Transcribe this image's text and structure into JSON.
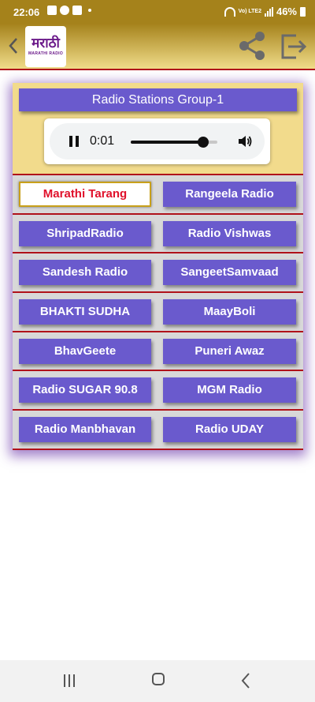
{
  "status_bar": {
    "time": "22:06",
    "battery": "46%",
    "network_label": "Vo) LTE2"
  },
  "app_bar": {
    "logo_main": "मराठी",
    "logo_sub": "MARATHI RADIO"
  },
  "group_title": "Radio Stations Group-1",
  "player": {
    "time": "0:01",
    "progress": 0.84
  },
  "stations": [
    [
      "Marathi Tarang",
      "Rangeela Radio"
    ],
    [
      "ShripadRadio",
      "Radio Vishwas"
    ],
    [
      "Sandesh Radio",
      "SangeetSamvaad"
    ],
    [
      "BHAKTI SUDHA",
      "MaayBoli"
    ],
    [
      "BhavGeete",
      "Puneri Awaz"
    ],
    [
      "Radio SUGAR 90.8",
      "MGM Radio"
    ],
    [
      "Radio Manbhavan",
      "Radio UDAY"
    ]
  ],
  "active_station": "Marathi Tarang",
  "colors": {
    "accent": "#6a5acd",
    "header_gold": "#a5821b",
    "panel_bg": "#f2db8c",
    "divider_red": "#b0121a",
    "active_text": "#e0112b"
  },
  "icons": {
    "back": "chevron-left-icon",
    "share": "share-icon",
    "exit": "exit-icon",
    "pause": "pause-icon",
    "volume": "volume-icon"
  }
}
